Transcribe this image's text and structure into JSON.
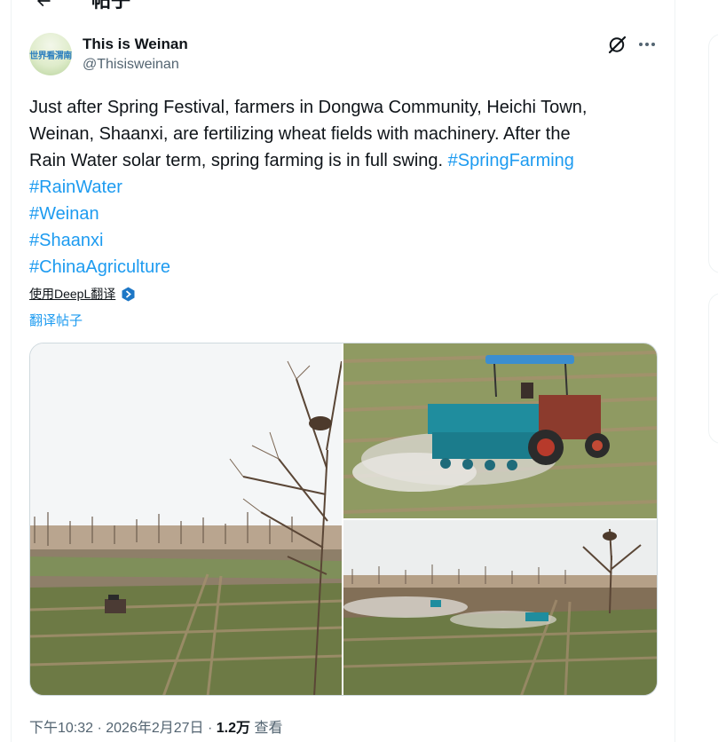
{
  "header": {
    "title": "帖子"
  },
  "author": {
    "avatar_text": "世界看渭南",
    "name": "This is Weinan",
    "handle": "@Thisisweinan"
  },
  "tweet": {
    "text_line1": "Just after Spring Festival, farmers in Dongwa Community, Heichi Town,",
    "text_line2": "Weinan, Shaanxi, are fertilizing wheat fields with machinery. After the",
    "text_line3": "Rain Water solar term, spring farming is in full swing. ",
    "hashtags": [
      "#SpringFarming",
      "#RainWater",
      "#Weinan",
      "#Shaanxi",
      "#ChinaAgriculture"
    ]
  },
  "translation": {
    "deepl_label": "使用DeepL翻译",
    "translate_label": "翻译帖子"
  },
  "meta": {
    "time": "下午10:32 · 2026年2月27日 · ",
    "views_count": "1.2万",
    "views_label": " 查看"
  },
  "colors": {
    "link": "#1d9bf0",
    "text": "#0f1419",
    "secondary": "#536471",
    "border": "#cfd9de"
  },
  "icons": [
    "back-arrow-icon",
    "grok-icon",
    "more-icon",
    "deepl-icon"
  ]
}
